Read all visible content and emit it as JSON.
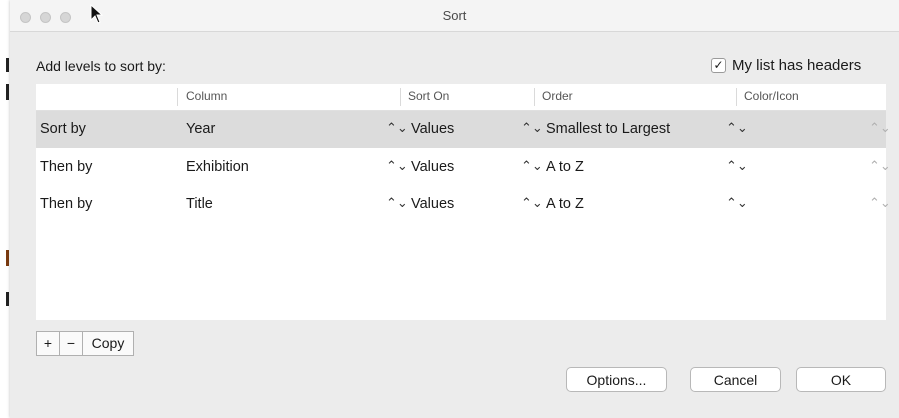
{
  "window": {
    "title": "Sort"
  },
  "dialog": {
    "add_levels_label": "Add levels to sort by:",
    "headers_checkbox": {
      "label": "My list has headers",
      "checked": true,
      "check_glyph": "✓"
    }
  },
  "table": {
    "columns": [
      "",
      "Column",
      "Sort On",
      "Order",
      "Color/Icon"
    ],
    "rows": [
      {
        "level": "Sort by",
        "column": "Year",
        "sort_on": "Values",
        "order": "Smallest to Largest",
        "color_icon": "",
        "selected": true
      },
      {
        "level": "Then by",
        "column": "Exhibition",
        "sort_on": "Values",
        "order": "A to Z",
        "color_icon": "",
        "selected": false
      },
      {
        "level": "Then by",
        "column": "Title",
        "sort_on": "Values",
        "order": "A to Z",
        "color_icon": "",
        "selected": false
      }
    ]
  },
  "level_buttons": {
    "add": "+",
    "remove": "−",
    "copy": "Copy"
  },
  "footer": {
    "options": "Options...",
    "cancel": "Cancel",
    "ok": "OK"
  },
  "icons": {
    "chevron": "⌃⌄",
    "up_down_chevron": "up-down-chevron-icon",
    "cursor": "arrow-cursor-icon"
  },
  "colors": {
    "selected_row": "#dcdcdc",
    "dialog_bg": "#ececec"
  }
}
